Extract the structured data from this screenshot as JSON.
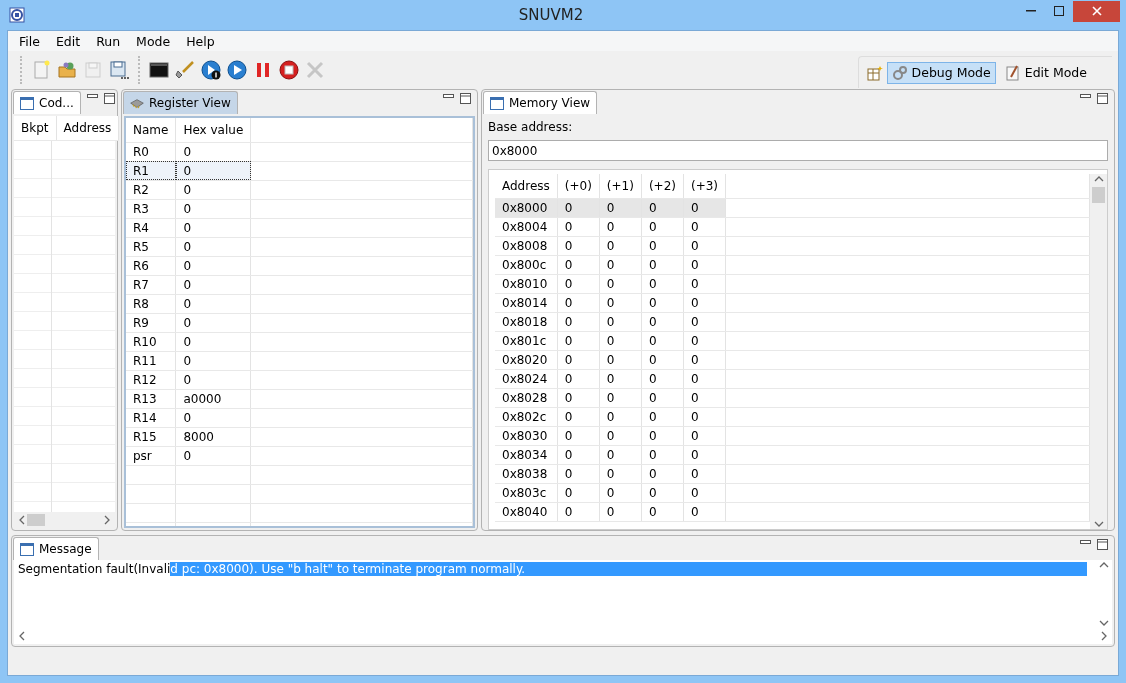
{
  "window": {
    "title": "SNUVM2"
  },
  "menu": [
    "File",
    "Edit",
    "Run",
    "Mode",
    "Help"
  ],
  "toolbar": [
    {
      "kind": "new",
      "disabled": false
    },
    {
      "kind": "open",
      "disabled": false
    },
    {
      "kind": "save",
      "disabled": true
    },
    {
      "kind": "saveas",
      "disabled": false
    },
    {
      "kind": "terminal",
      "disabled": false
    },
    {
      "kind": "shovel",
      "disabled": false
    },
    {
      "kind": "step",
      "disabled": false
    },
    {
      "kind": "run",
      "disabled": false
    },
    {
      "kind": "pause",
      "disabled": false
    },
    {
      "kind": "stop",
      "disabled": false
    },
    {
      "kind": "tools",
      "disabled": true
    }
  ],
  "modes": [
    {
      "label": "Debug Mode",
      "kind": "debug",
      "selected": true
    },
    {
      "label": "Edit Mode",
      "kind": "edit",
      "selected": false
    }
  ],
  "code_panel": {
    "tab": "Cod...",
    "columns": [
      "Bkpt",
      "Address"
    ]
  },
  "register_panel": {
    "tab": "Register View",
    "columns": [
      "Name",
      "Hex value"
    ],
    "rows": [
      {
        "name": "R0",
        "value": "0",
        "selected": false
      },
      {
        "name": "R1",
        "value": "0",
        "selected": true
      },
      {
        "name": "R2",
        "value": "0",
        "selected": false
      },
      {
        "name": "R3",
        "value": "0",
        "selected": false
      },
      {
        "name": "R4",
        "value": "0",
        "selected": false
      },
      {
        "name": "R5",
        "value": "0",
        "selected": false
      },
      {
        "name": "R6",
        "value": "0",
        "selected": false
      },
      {
        "name": "R7",
        "value": "0",
        "selected": false
      },
      {
        "name": "R8",
        "value": "0",
        "selected": false
      },
      {
        "name": "R9",
        "value": "0",
        "selected": false
      },
      {
        "name": "R10",
        "value": "0",
        "selected": false
      },
      {
        "name": "R11",
        "value": "0",
        "selected": false
      },
      {
        "name": "R12",
        "value": "0",
        "selected": false
      },
      {
        "name": "R13",
        "value": "a0000",
        "selected": false
      },
      {
        "name": "R14",
        "value": "0",
        "selected": false
      },
      {
        "name": "R15",
        "value": "8000",
        "selected": false
      },
      {
        "name": "psr",
        "value": "0",
        "selected": false
      }
    ]
  },
  "memory_panel": {
    "tab": "Memory View",
    "base_label": "Base address:",
    "base_value": "0x8000",
    "columns": [
      "Address",
      "(+0)",
      "(+1)",
      "(+2)",
      "(+3)"
    ],
    "rows": [
      {
        "cells": [
          "0x8000",
          "0",
          "0",
          "0",
          "0"
        ],
        "selected": true
      },
      {
        "cells": [
          "0x8004",
          "0",
          "0",
          "0",
          "0"
        ],
        "selected": false
      },
      {
        "cells": [
          "0x8008",
          "0",
          "0",
          "0",
          "0"
        ],
        "selected": false
      },
      {
        "cells": [
          "0x800c",
          "0",
          "0",
          "0",
          "0"
        ],
        "selected": false
      },
      {
        "cells": [
          "0x8010",
          "0",
          "0",
          "0",
          "0"
        ],
        "selected": false
      },
      {
        "cells": [
          "0x8014",
          "0",
          "0",
          "0",
          "0"
        ],
        "selected": false
      },
      {
        "cells": [
          "0x8018",
          "0",
          "0",
          "0",
          "0"
        ],
        "selected": false
      },
      {
        "cells": [
          "0x801c",
          "0",
          "0",
          "0",
          "0"
        ],
        "selected": false
      },
      {
        "cells": [
          "0x8020",
          "0",
          "0",
          "0",
          "0"
        ],
        "selected": false
      },
      {
        "cells": [
          "0x8024",
          "0",
          "0",
          "0",
          "0"
        ],
        "selected": false
      },
      {
        "cells": [
          "0x8028",
          "0",
          "0",
          "0",
          "0"
        ],
        "selected": false
      },
      {
        "cells": [
          "0x802c",
          "0",
          "0",
          "0",
          "0"
        ],
        "selected": false
      },
      {
        "cells": [
          "0x8030",
          "0",
          "0",
          "0",
          "0"
        ],
        "selected": false
      },
      {
        "cells": [
          "0x8034",
          "0",
          "0",
          "0",
          "0"
        ],
        "selected": false
      },
      {
        "cells": [
          "0x8038",
          "0",
          "0",
          "0",
          "0"
        ],
        "selected": false
      },
      {
        "cells": [
          "0x803c",
          "0",
          "0",
          "0",
          "0"
        ],
        "selected": false
      },
      {
        "cells": [
          "0x8040",
          "0",
          "0",
          "0",
          "0"
        ],
        "selected": false
      }
    ]
  },
  "message_panel": {
    "tab": "Message",
    "text": "Segmentation fault(Invali",
    "selected_text": "d pc: 0x8000). Use \"b halt\" to terminate program normally."
  }
}
